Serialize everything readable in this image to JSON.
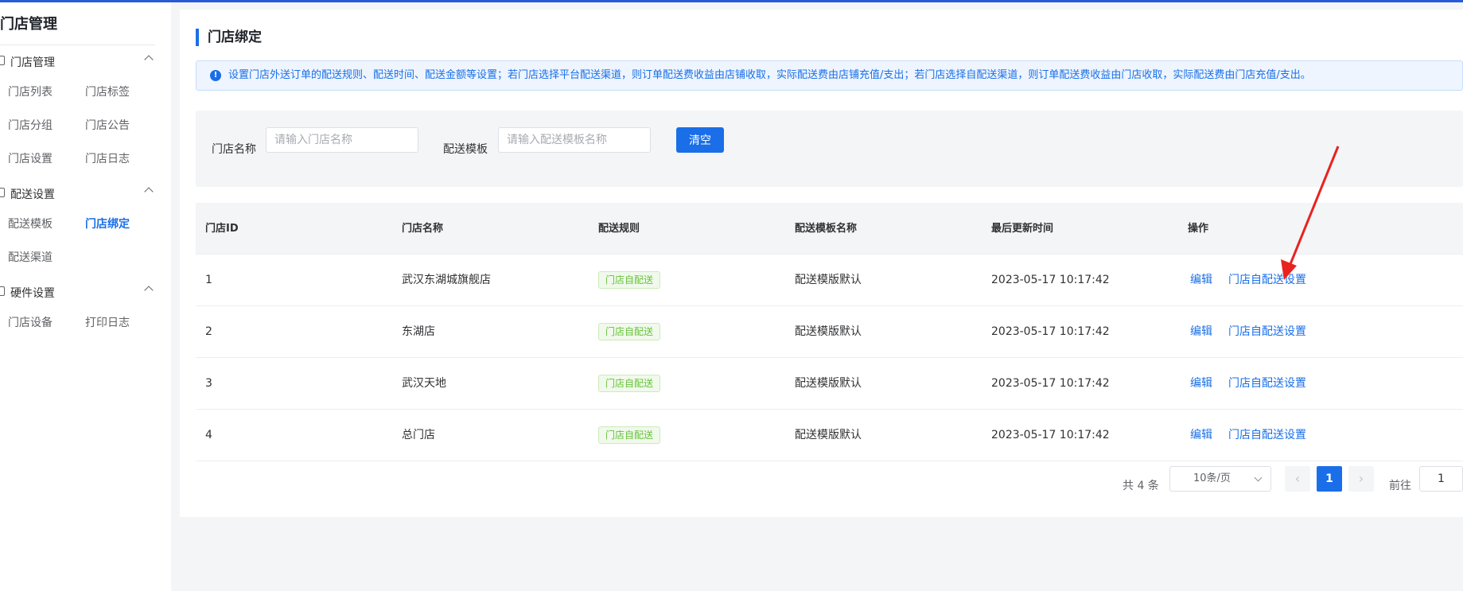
{
  "sidebar": {
    "title": "门店管理",
    "groups": [
      {
        "label": "门店管理",
        "items": [
          "门店列表",
          "门店标签",
          "门店分组",
          "门店公告",
          "门店设置",
          "门店日志"
        ]
      },
      {
        "label": "配送设置",
        "items": [
          "配送模板",
          "门店绑定",
          "配送渠道"
        ]
      },
      {
        "label": "硬件设置",
        "items": [
          "门店设备",
          "打印日志"
        ]
      }
    ],
    "active_item": "门店绑定"
  },
  "page": {
    "title": "门店绑定",
    "alert": "设置门店外送订单的配送规则、配送时间、配送金额等设置；若门店选择平台配送渠道，则订单配送费收益由店铺收取，实际配送费由店铺充值/支出；若门店选择自配送渠道，则订单配送费收益由门店收取，实际配送费由门店充值/支出。"
  },
  "filters": {
    "store_name_label": "门店名称",
    "store_name_placeholder": "请输入门店名称",
    "template_label": "配送模板",
    "template_placeholder": "请输入配送模板名称",
    "clear_button": "清空"
  },
  "table": {
    "columns": [
      "门店ID",
      "门店名称",
      "配送规则",
      "配送模板名称",
      "最后更新时间",
      "操作"
    ],
    "rows": [
      {
        "id": "1",
        "name": "武汉东湖城旗舰店",
        "rule": "门店自配送",
        "template": "配送模版默认",
        "updated": "2023-05-17 10:17:42",
        "action_edit": "编辑",
        "action_setting": "门店自配送设置"
      },
      {
        "id": "2",
        "name": "东湖店",
        "rule": "门店自配送",
        "template": "配送模版默认",
        "updated": "2023-05-17 10:17:42",
        "action_edit": "编辑",
        "action_setting": "门店自配送设置"
      },
      {
        "id": "3",
        "name": "武汉天地",
        "rule": "门店自配送",
        "template": "配送模版默认",
        "updated": "2023-05-17 10:17:42",
        "action_edit": "编辑",
        "action_setting": "门店自配送设置"
      },
      {
        "id": "4",
        "name": "总门店",
        "rule": "门店自配送",
        "template": "配送模版默认",
        "updated": "2023-05-17 10:17:42",
        "action_edit": "编辑",
        "action_setting": "门店自配送设置"
      }
    ]
  },
  "pagination": {
    "total": "共 4 条",
    "page_size": "10条/页",
    "prev": "‹",
    "next": "›",
    "current_page": "1",
    "goto_label": "前往",
    "goto_value": "1"
  },
  "colors": {
    "primary": "#1a6fe8",
    "tag_green": "#67c23a",
    "annotation_arrow": "#e8231f"
  }
}
